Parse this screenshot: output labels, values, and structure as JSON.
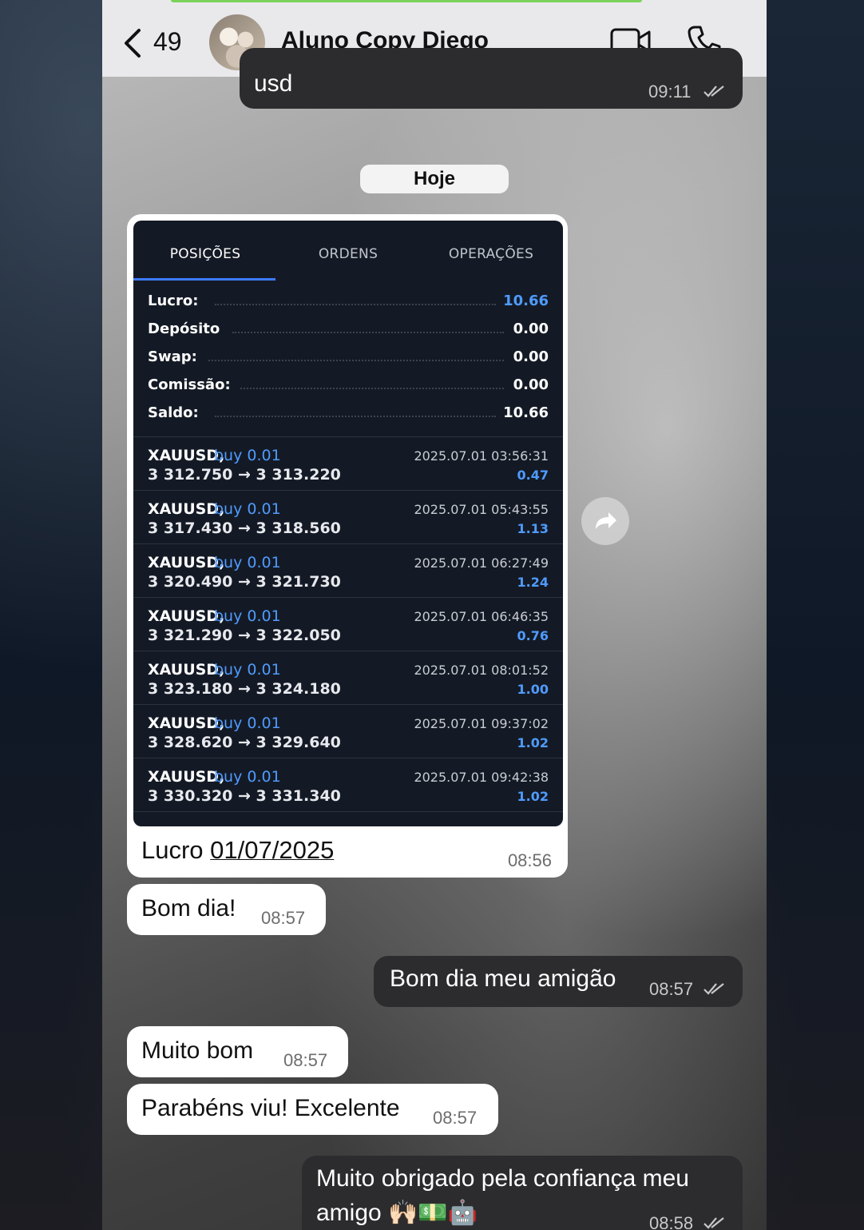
{
  "header": {
    "unread_count": "49",
    "chat_title": "Aluno Copy Diego"
  },
  "messages": {
    "first": {
      "text": "usd",
      "time": "09:11"
    },
    "date_chip": "Hoje",
    "image_caption": {
      "prefix": "Lucro ",
      "date": "01/07/2025",
      "time": "08:56"
    },
    "m1": {
      "text": "Bom dia!",
      "time": "08:57"
    },
    "m2": {
      "text": "Bom dia meu amigão",
      "time": "08:57"
    },
    "m3": {
      "text": "Muito bom",
      "time": "08:57"
    },
    "m4": {
      "text": "Parabéns viu! Excelente",
      "time": "08:57"
    },
    "m5": {
      "line1": "Muito obrigado pela confiança meu",
      "line2": "amigo 🙌🏻💵🤖",
      "time": "08:58"
    }
  },
  "trading": {
    "tabs": [
      "POSIÇÕES",
      "ORDENS",
      "OPERAÇÕES"
    ],
    "summary": [
      {
        "label": "Lucro:",
        "value": "10.66"
      },
      {
        "label": "Depósito",
        "value": "0.00"
      },
      {
        "label": "Swap:",
        "value": "0.00"
      },
      {
        "label": "Comissão:",
        "value": "0.00"
      },
      {
        "label": "Saldo:",
        "value": "10.66"
      }
    ],
    "trades": [
      {
        "symbol": "XAUUSD,",
        "side": "buy 0.01",
        "prices": "3 312.750 → 3 313.220",
        "datetime": "2025.07.01 03:56:31",
        "profit": "0.47"
      },
      {
        "symbol": "XAUUSD,",
        "side": "buy 0.01",
        "prices": "3 317.430 → 3 318.560",
        "datetime": "2025.07.01 05:43:55",
        "profit": "1.13"
      },
      {
        "symbol": "XAUUSD,",
        "side": "buy 0.01",
        "prices": "3 320.490 → 3 321.730",
        "datetime": "2025.07.01 06:27:49",
        "profit": "1.24"
      },
      {
        "symbol": "XAUUSD,",
        "side": "buy 0.01",
        "prices": "3 321.290 → 3 322.050",
        "datetime": "2025.07.01 06:46:35",
        "profit": "0.76"
      },
      {
        "symbol": "XAUUSD,",
        "side": "buy 0.01",
        "prices": "3 323.180 → 3 324.180",
        "datetime": "2025.07.01 08:01:52",
        "profit": "1.00"
      },
      {
        "symbol": "XAUUSD,",
        "side": "buy 0.01",
        "prices": "3 328.620 → 3 329.640",
        "datetime": "2025.07.01 09:37:02",
        "profit": "1.02"
      },
      {
        "symbol": "XAUUSD,",
        "side": "buy 0.01",
        "prices": "3 330.320 → 3 331.340",
        "datetime": "2025.07.01 09:42:38",
        "profit": "1.02"
      }
    ]
  },
  "colors": {
    "outgoing_bubble": "#2c2c2e",
    "incoming_bubble": "#ffffff",
    "accent_blue": "#4f9bff",
    "panel_bg": "#141a25"
  },
  "icons": [
    "back-chevron-icon",
    "video-call-icon",
    "phone-call-icon",
    "read-ticks-icon",
    "forward-share-icon"
  ]
}
